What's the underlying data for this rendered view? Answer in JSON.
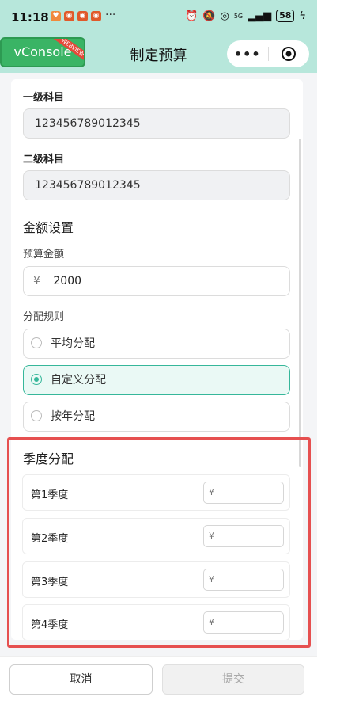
{
  "status_bar": {
    "time": "11:18",
    "signal_text": "5G",
    "battery": "58",
    "app_icons": [
      "weibo-icon",
      "weibo-icon",
      "weibo-icon",
      "weibo-icon"
    ]
  },
  "nav": {
    "vconsole_label": "vConsole",
    "vconsole_ribbon": "WEBVIEW",
    "title": "制定预算",
    "more_label": "•••"
  },
  "form": {
    "level1": {
      "label": "一级科目",
      "value": "123456789012345"
    },
    "level2": {
      "label": "二级科目",
      "value": "123456789012345"
    },
    "amount_section": "金额设置",
    "budget_label": "预算金额",
    "currency": "¥",
    "budget_value": "2000",
    "rule_label": "分配规则",
    "rules": [
      "平均分配",
      "自定义分配",
      "按年分配"
    ],
    "selected_rule": "自定义分配",
    "quarter_section": "季度分配",
    "quarters": [
      {
        "label": "第1季度",
        "placeholder": "¥"
      },
      {
        "label": "第2季度",
        "placeholder": "¥"
      },
      {
        "label": "第3季度",
        "placeholder": "¥"
      },
      {
        "label": "第4季度",
        "placeholder": "¥"
      }
    ]
  },
  "footer": {
    "cancel_label": "取消",
    "submit_label": "提交"
  },
  "colors": {
    "header_bg": "#b7e7db",
    "accent": "#36b79a",
    "highlight_border": "#e65050",
    "vconsole_green": "#3ab465"
  }
}
